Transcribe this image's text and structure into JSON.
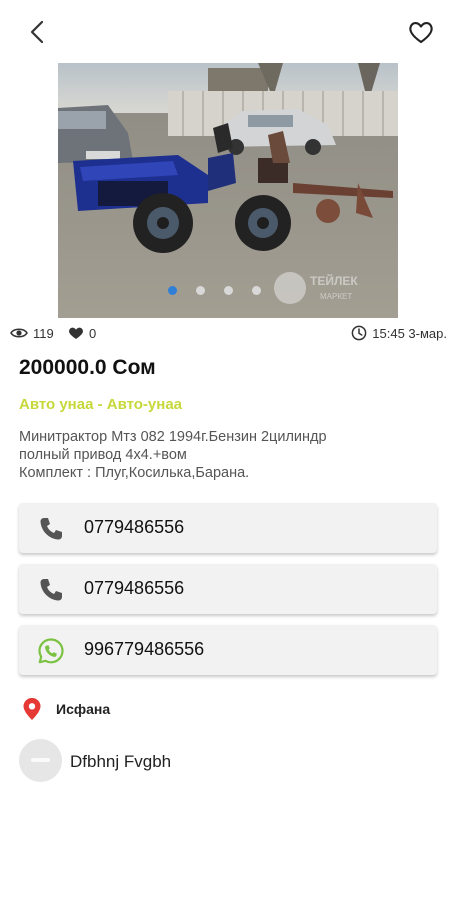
{
  "header": {
    "back_icon": "arrow-left-icon",
    "favorite_icon": "heart-outline-icon"
  },
  "gallery": {
    "image_description": "blue mini tractor with plough parked outside",
    "slide_count": 4,
    "active_slide": 1,
    "watermark": "ТЕЙЛЕК"
  },
  "stats": {
    "views": "119",
    "likes": "0",
    "time": "15:45 3-мар."
  },
  "listing": {
    "price": "200000.0 Сом",
    "category": "Авто унаа - Авто-унаа",
    "description": "Минитрактор Мтз 082 1994г.Бензин 2цилиндр\nполный привод 4x4.+вом\nКомплект : Плуг,Косилька,Барана."
  },
  "contacts": [
    {
      "icon": "phone-icon",
      "number": "0779486556"
    },
    {
      "icon": "phone-icon",
      "number": "0779486556"
    },
    {
      "icon": "whatsapp-icon",
      "number": "996779486556"
    }
  ],
  "location": {
    "icon": "map-pin-icon",
    "label": "Исфана"
  },
  "seller": {
    "name": "Dfbhnj Fvgbh"
  },
  "colors": {
    "accent_blue": "#2f7fd6",
    "category_green": "#c7d83a",
    "pin_red": "#e53935",
    "whatsapp_green": "#7cc242"
  }
}
